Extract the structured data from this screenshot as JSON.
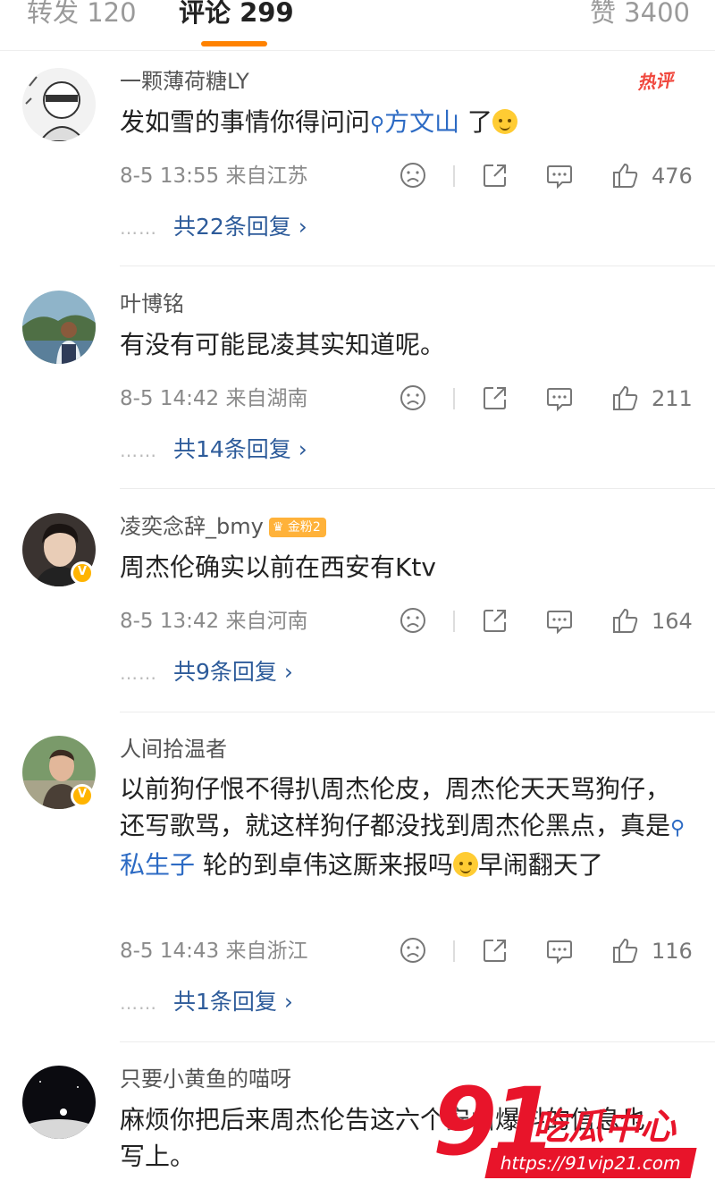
{
  "tabs": [
    {
      "label": "转发 120",
      "active": false
    },
    {
      "label": "评论 299",
      "active": true
    },
    {
      "label": "赞 3400",
      "active": false
    }
  ],
  "accent_color": "#ff8200",
  "link_color": "#2d6bc4",
  "comments": [
    {
      "username": "一颗薄荷糖LY",
      "hot_badge": "热评",
      "body_before": "发如雪的事情你得问问",
      "topic": "方文山",
      "body_after": " 了",
      "time": "8-5 13:55",
      "location": "来自江苏",
      "likes": "476",
      "replies": "共22条回复 ›",
      "reply_dots": "……"
    },
    {
      "username": "叶博铭",
      "body": "有没有可能昆凌其实知道呢。",
      "time": "8-5 14:42",
      "location": "来自湖南",
      "likes": "211",
      "replies": "共14条回复 ›",
      "reply_dots": "……"
    },
    {
      "username": "凌奕念辞_bmy",
      "fan_badge": "金粉2",
      "body": "周杰伦确实以前在西安有Ktv",
      "time": "8-5 13:42",
      "location": "来自河南",
      "likes": "164",
      "replies": "共9条回复 ›",
      "reply_dots": "……"
    },
    {
      "username": "人间拾温者",
      "body_before": "以前狗仔恨不得扒周杰伦皮，周杰伦天天骂狗仔，还写歌骂，就这样狗仔都没找到周杰伦黑点，真是",
      "topic": "私生子",
      "body_after": " 轮的到卓伟这厮来报吗",
      "body_end": "早闹翻天了",
      "time": "8-5 14:43",
      "location": "来自浙江",
      "likes": "116",
      "replies": "共1条回复 ›",
      "reply_dots": "……"
    },
    {
      "username": "只要小黄鱼的喵呀",
      "body": "麻烦你把后来周杰伦告这六个安山爆料的信息也写上。"
    }
  ],
  "watermark": {
    "number": "91",
    "title": "吃瓜中心",
    "url": "https://91vip21.com"
  }
}
